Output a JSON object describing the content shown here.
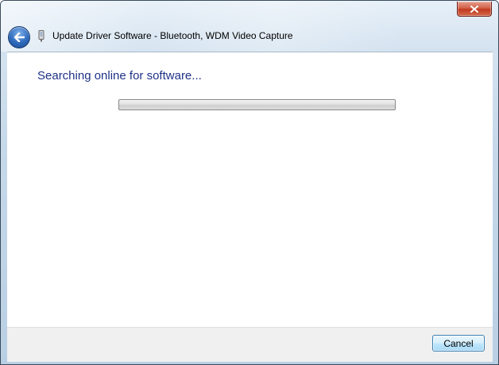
{
  "window": {
    "title": "Update Driver Software - Bluetooth, WDM Video Capture",
    "close_icon": "close-icon",
    "back_icon": "back-arrow-icon",
    "device_icon": "device-icon"
  },
  "main": {
    "heading": "Searching online for software...",
    "progress": {
      "fraction": 0
    }
  },
  "footer": {
    "cancel_label": "Cancel"
  }
}
